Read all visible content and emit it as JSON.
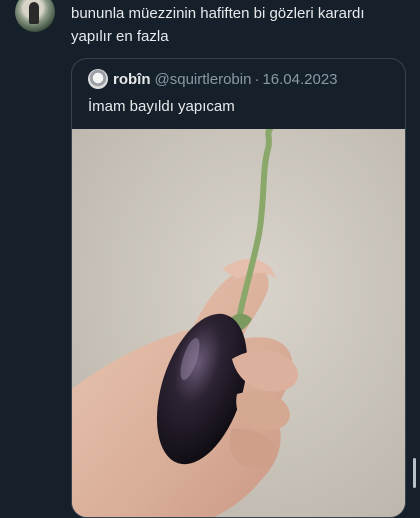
{
  "tweet": {
    "text": "bununla müezzinin hafiften bi gözleri karardı\nyapılır en fazla"
  },
  "quoted_tweet": {
    "author_name": "robîn",
    "author_handle": "@squirtlerobin",
    "separator": "·",
    "date": "16.04.2023",
    "text": "İmam bayıldı yapıcam",
    "media_icon": "photo-eggplant-in-hand"
  },
  "colors": {
    "background": "#15202b",
    "text": "#e7e9ea",
    "secondary_text": "#8b98a5",
    "border": "#38444d"
  }
}
